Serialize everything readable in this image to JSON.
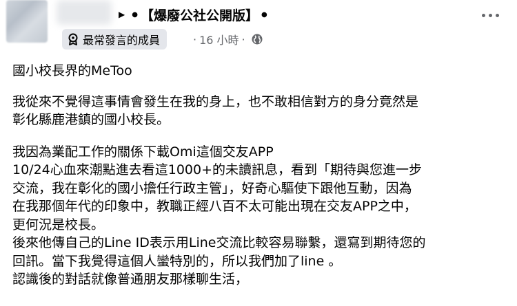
{
  "post": {
    "group_name": "【爆廢公社公開版】",
    "badge_label": "最常發言的成員",
    "time": "16 小時",
    "meta_separator": "·",
    "title": "國小校長界的MeToo",
    "para1": [
      "我從來不覺得這事情會發生在我的身上，也不敢相信對方的身分竟然是",
      "彰化縣鹿港鎮的國小校長。"
    ],
    "para2": [
      "我因為業配工作的關係下載Omi這個交友APP",
      "10/24心血來潮點進去看這1000+的未讀訊息，看到「期待與您進一步",
      "交流，我在彰化的國小擔任行政主管」，好奇心驅使下跟他互動，因為",
      "在我那個年代的印象中，教職正經八百不太可能出現在交友APP之中，",
      "更何況是校長。",
      "後來他傳自己的Line ID表示用Line交流比較容易聯繫，還寫到期待您的",
      "回訊。當下我覺得這個人蠻特別的，所以我們加了line 。",
      "認識後的對話就像普通朋友那樣聊生活，"
    ]
  },
  "icons": {
    "badge": "member-badge-icon",
    "globe": "globe-icon",
    "more": "more-options-icon",
    "arrow": "group-arrow-icon"
  }
}
